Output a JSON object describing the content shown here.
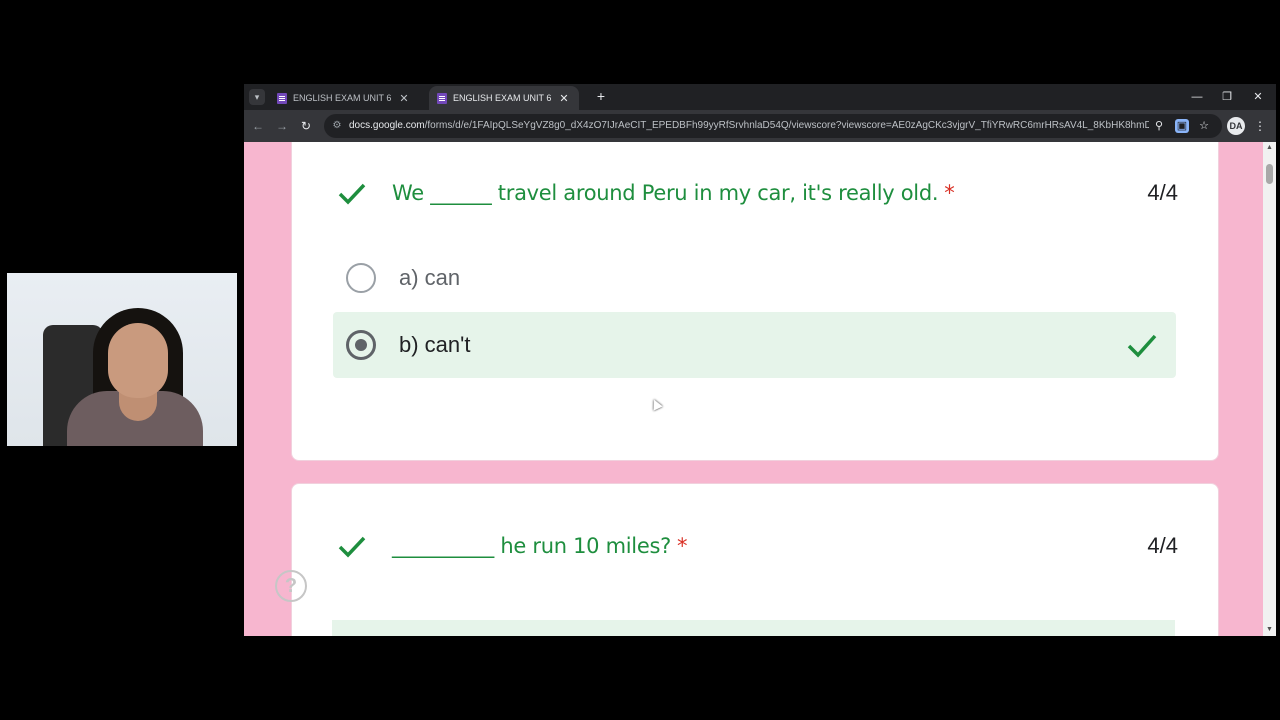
{
  "browser": {
    "tabs": [
      {
        "title": "ENGLISH EXAM UNIT 6",
        "active": false
      },
      {
        "title": "ENGLISH EXAM UNIT 6",
        "active": true
      }
    ],
    "url_host": "docs.google.com",
    "url_path": "/forms/d/e/1FAIpQLSeYgVZ8g0_dX4zO7IJrAeCIT_EPEDBFh99yyRfSrvhnlaD54Q/viewscore?viewscore=AE0zAgCKc3vjgrV_TfiYRwRC6mrHRsAV4L_8KbHK8hmDBvyvhJd6fmBFV9...",
    "profile_initials": "DA"
  },
  "questions": [
    {
      "text": "We ______ travel around Peru in my car, it's really old.",
      "required_mark": "*",
      "score": "4/4",
      "options": [
        {
          "label": "a) can",
          "selected": false,
          "correct": false
        },
        {
          "label": "b) can't",
          "selected": true,
          "correct": true
        }
      ]
    },
    {
      "text": "__________ he run 10 miles?",
      "required_mark": "*",
      "score": "4/4"
    }
  ],
  "colors": {
    "page_background": "#f7b6cf",
    "correct_green": "#1e8e3e",
    "correct_option_bg": "#e6f4ea",
    "required_red": "#d93025"
  },
  "icons": {
    "help": "?",
    "check": "check-icon"
  }
}
